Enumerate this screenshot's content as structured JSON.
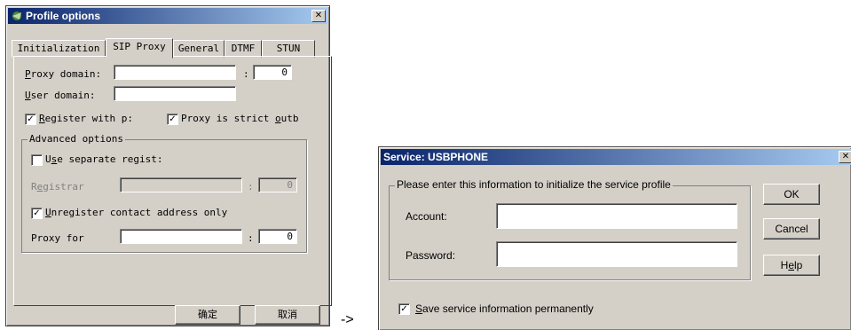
{
  "profile_dialog": {
    "title": "Profile options",
    "tabs": [
      "Initialization",
      "SIP Proxy",
      "General",
      "DTMF",
      "STUN"
    ],
    "selected_tab": "SIP Proxy",
    "proxy_domain": {
      "label": "Proxy domain:",
      "value": "",
      "port": "0"
    },
    "user_domain": {
      "label": "User domain:",
      "value": ""
    },
    "register_with_proxy": {
      "label": "Register with p:",
      "checked": true
    },
    "proxy_strict": {
      "label": "Proxy is strict outb",
      "checked": true
    },
    "advanced": {
      "title": "Advanced options",
      "use_separate_registrar": {
        "label": "Use separate regist:",
        "checked": false
      },
      "registrar": {
        "label": "Registrar",
        "value": "",
        "port": "0"
      },
      "unregister_contact": {
        "label": "Unregister contact address only",
        "checked": true
      },
      "proxy_for": {
        "label": "Proxy for",
        "value": "",
        "port": "0"
      }
    },
    "ok_label": "确定",
    "cancel_label": "取消",
    "port_separator": ":"
  },
  "arrow_text": "->",
  "service_dialog": {
    "title": "Service: USBPHONE",
    "group_title": "Please enter this information to initialize the service profile",
    "account_label": "Account:",
    "account_value": "",
    "password_label": "Password:",
    "password_value": "",
    "ok_label": "OK",
    "cancel_label": "Cancel",
    "help_label": "Help",
    "save_label": "Save service information permanently",
    "save_checked": true
  },
  "colors": {
    "titlebar_start": "#0a246a",
    "titlebar_end": "#a6caf0",
    "window_face": "#d4d0c8"
  }
}
